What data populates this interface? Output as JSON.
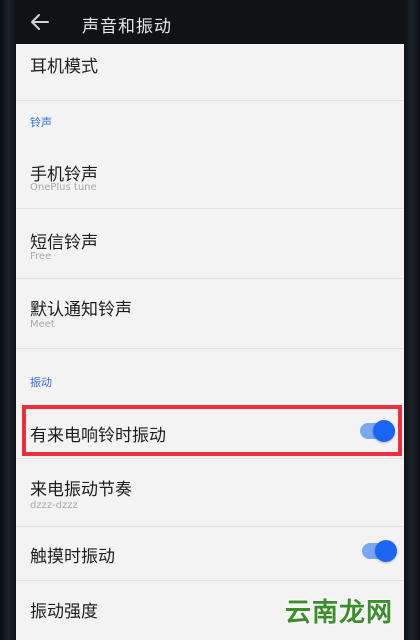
{
  "appbar": {
    "title": "声音和振动",
    "back_icon": "arrow-left-icon"
  },
  "items": {
    "earphone_mode": {
      "title": "耳机模式"
    },
    "ringtone_section": {
      "header": "铃声"
    },
    "phone_ringtone": {
      "title": "手机铃声",
      "value": "OnePlus tune"
    },
    "sms_ringtone": {
      "title": "短信铃声",
      "value": "Free"
    },
    "notification_ringtone": {
      "title": "默认通知铃声",
      "value": "Meet"
    },
    "vibration_section": {
      "header": "振动"
    },
    "vibrate_on_ring": {
      "title": "有来电响铃时振动",
      "enabled": true
    },
    "call_vibration_pattern": {
      "title": "来电振动节奏",
      "value": "dzzz-dzzz"
    },
    "touch_vibration": {
      "title": "触摸时振动",
      "enabled": true
    },
    "vibration_intensity": {
      "title": "振动强度"
    }
  },
  "watermark": {
    "text": "云南龙网"
  },
  "colors": {
    "accent": "#1c64f2",
    "highlight": "#ef2f3c",
    "section_header": "#2f6fe4"
  }
}
